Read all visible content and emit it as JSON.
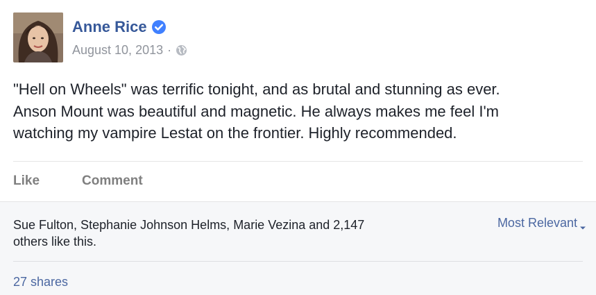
{
  "post": {
    "author": "Anne Rice",
    "date": "August 10, 2013",
    "separator": "·",
    "body_lines": [
      "\"Hell on Wheels\" was terrific tonight, and as brutal and stunning as ever.",
      "Anson Mount was beautiful and magnetic. He always makes me feel I'm",
      "watching my vampire Lestat on the frontier. Highly recommended."
    ],
    "verified_icon": "verified-badge-icon",
    "privacy_icon": "globe-icon"
  },
  "actions": {
    "like_label": "Like",
    "comment_label": "Comment"
  },
  "feedback": {
    "likes_line1": "Sue Fulton, Stephanie Johnson Helms, Marie Vezina and 2,147",
    "likes_line2": "others like this.",
    "sort_label": "Most Relevant",
    "shares_label": "27 shares"
  },
  "colors": {
    "author_link": "#365899",
    "link": "#4b67a1",
    "verified": "#4080ff",
    "muted": "#90949c",
    "text": "#1d2129",
    "feedback_bg": "#f6f7f9"
  }
}
